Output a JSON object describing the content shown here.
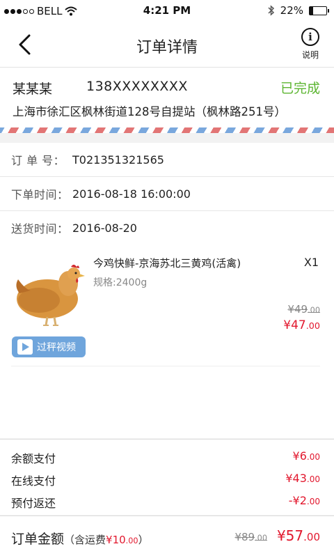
{
  "status_bar": {
    "carrier": "BELL",
    "time": "4:21 PM",
    "battery": "22%",
    "battery_level": 0.22
  },
  "nav": {
    "title": "订单详情",
    "help_label": "说明"
  },
  "recipient": {
    "name": "某某某",
    "phone": "138XXXXXXXX",
    "status": "已完成",
    "address": "上海市徐汇区枫林街道128号自提站（枫林路251号）"
  },
  "order_info": [
    {
      "key": "订 单 号：",
      "value": "T021351321565"
    },
    {
      "key": "下单时间：",
      "value": "2016-08-18 16:00:00"
    },
    {
      "key": "送货时间：",
      "value": "2016-08-20"
    }
  ],
  "product": {
    "name": "今鸡快鲜-京海苏北三黄鸡(活禽)",
    "quantity": "X1",
    "spec": "规格:2400g",
    "original_price_main": "¥49",
    "original_price_dec": ".00",
    "price_main": "¥47",
    "price_dec": ".00",
    "video_label": "过秤视频"
  },
  "payments": [
    {
      "label": "余额支付",
      "main": "¥6",
      "dec": ".00"
    },
    {
      "label": "在线支付",
      "main": "¥43",
      "dec": ".00"
    },
    {
      "label": "预付返还",
      "main": "-¥2",
      "dec": ".00"
    }
  ],
  "total": {
    "label": "订单金额",
    "shipping_prefix": "（含运费",
    "shipping_main": "¥10",
    "shipping_dec": ".00",
    "shipping_suffix": "）",
    "original_main": "¥89",
    "original_dec": ".00",
    "amount_main": "¥57",
    "amount_dec": ".00"
  },
  "colors": {
    "status_green": "#5cb531",
    "price_red": "#e2182e",
    "video_button": "#6fa5dc"
  }
}
